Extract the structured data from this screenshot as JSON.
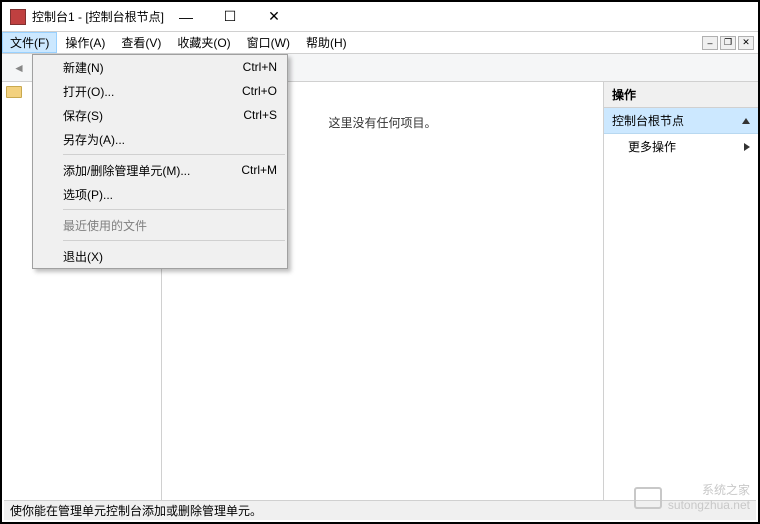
{
  "titlebar": {
    "title": "控制台1 - [控制台根节点]"
  },
  "menubar": {
    "file": "文件(F)",
    "action": "操作(A)",
    "view": "查看(V)",
    "favorites": "收藏夹(O)",
    "window": "窗口(W)",
    "help": "帮助(H)"
  },
  "dropdown": {
    "new": {
      "label": "新建(N)",
      "shortcut": "Ctrl+N"
    },
    "open": {
      "label": "打开(O)...",
      "shortcut": "Ctrl+O"
    },
    "save": {
      "label": "保存(S)",
      "shortcut": "Ctrl+S"
    },
    "saveas": {
      "label": "另存为(A)..."
    },
    "addremove": {
      "label": "添加/删除管理单元(M)...",
      "shortcut": "Ctrl+M"
    },
    "options": {
      "label": "选项(P)..."
    },
    "recent": {
      "label": "最近使用的文件"
    },
    "exit": {
      "label": "退出(X)"
    }
  },
  "content": {
    "empty": "这里没有任何项目。"
  },
  "actions": {
    "header": "操作",
    "section": "控制台根节点",
    "more": "更多操作"
  },
  "statusbar": {
    "text": "使你能在管理单元控制台添加或删除管理单元。"
  },
  "watermark": {
    "line1": "系统之家",
    "line2": "sutongzhua.net"
  }
}
